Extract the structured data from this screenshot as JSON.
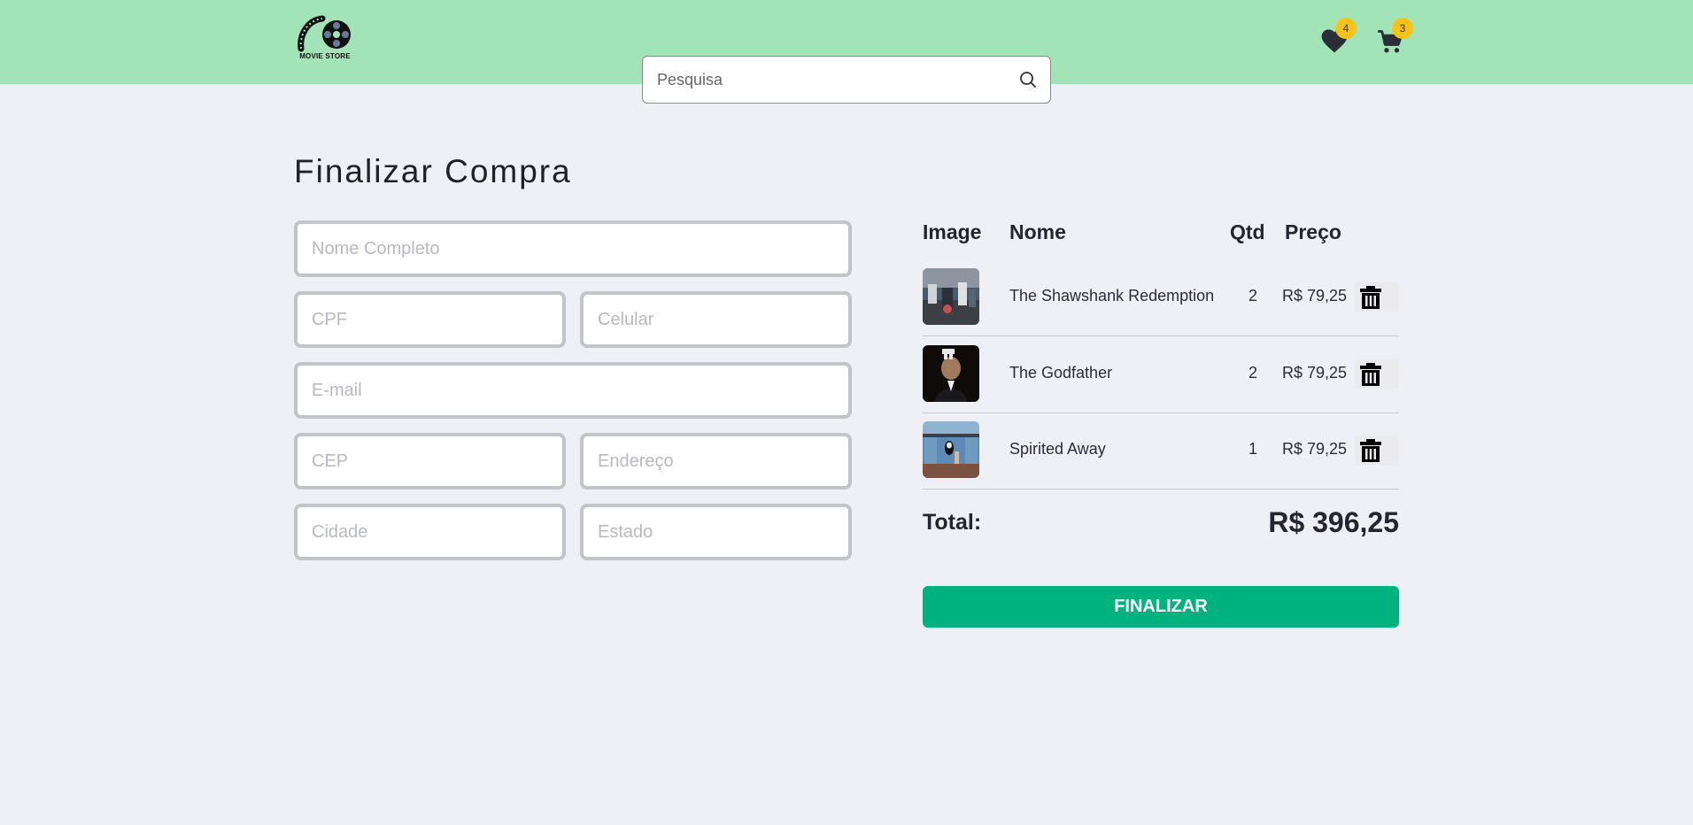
{
  "header": {
    "logo_text": "MOVIE STORE",
    "search": {
      "placeholder": "Pesquisa",
      "value": ""
    },
    "favorites_count": "4",
    "cart_count": "3"
  },
  "checkout": {
    "title": "Finalizar Compra",
    "fields": {
      "nome": "Nome Completo",
      "cpf": "CPF",
      "celular": "Celular",
      "email": "E-mail",
      "cep": "CEP",
      "endereco": "Endereço",
      "cidade": "Cidade",
      "estado": "Estado"
    }
  },
  "cart": {
    "headers": {
      "image": "Image",
      "nome": "Nome",
      "qtd": "Qtd",
      "preco": "Preço"
    },
    "items": [
      {
        "name": "The Shawshank Redemption",
        "qty": "2",
        "price": "R$ 79,25"
      },
      {
        "name": "The Godfather",
        "qty": "2",
        "price": "R$ 79,25"
      },
      {
        "name": "Spirited Away",
        "qty": "1",
        "price": "R$ 79,25"
      }
    ],
    "total_label": "Total:",
    "total_value": "R$ 396,25",
    "finalize_label": "FINALIZAR"
  },
  "colors": {
    "header_bg": "#a2e4b8",
    "page_bg": "#eff0f5",
    "accent": "#00b37e",
    "badge": "#f8c21a"
  }
}
